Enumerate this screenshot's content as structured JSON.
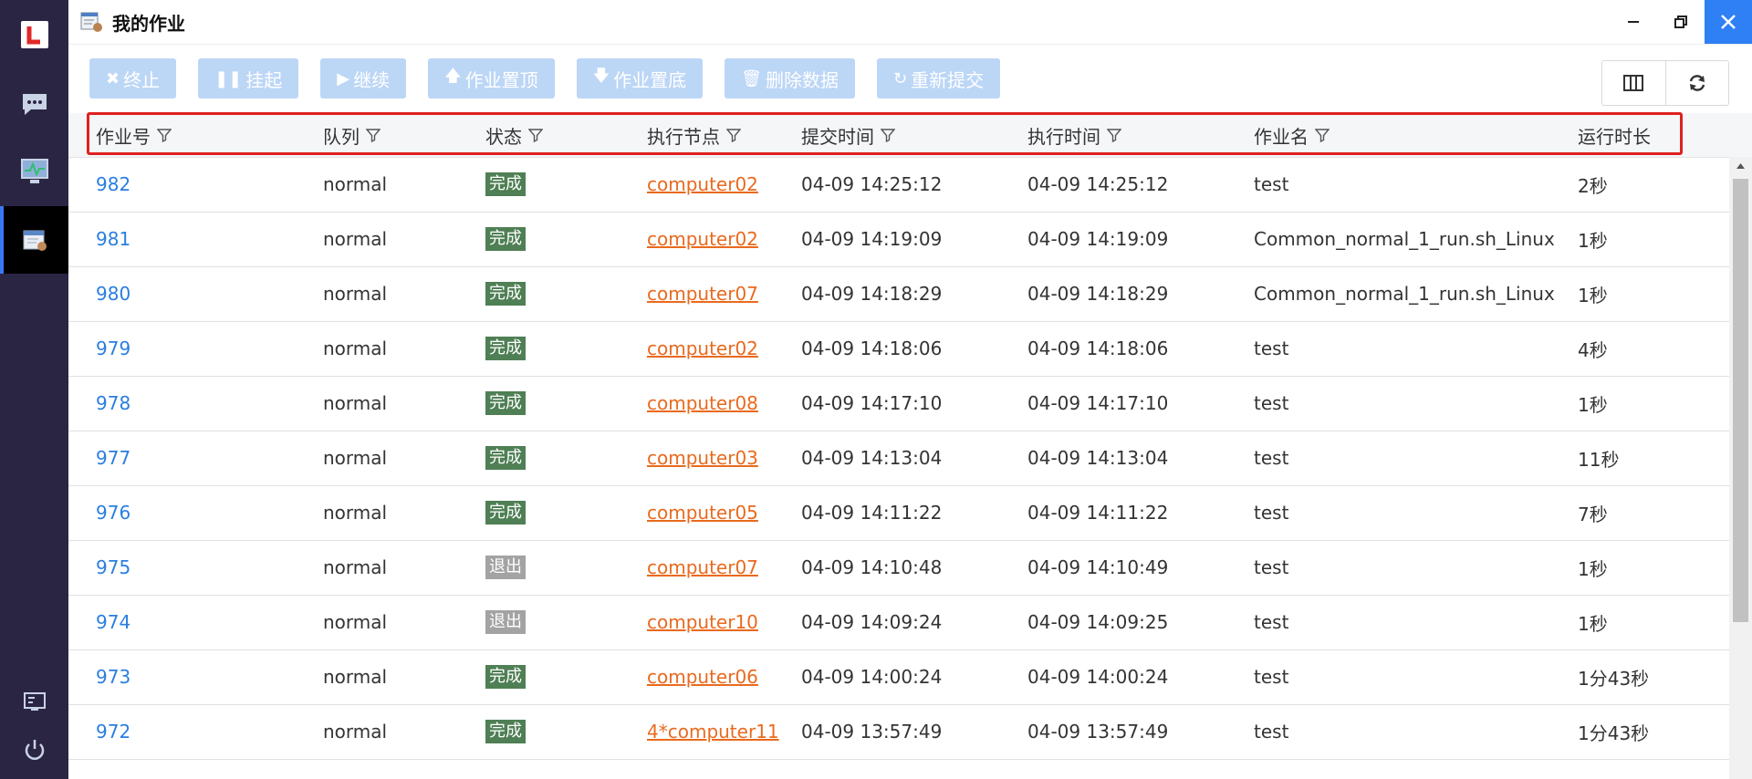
{
  "window": {
    "title": "我的作业"
  },
  "toolbar": {
    "buttons": [
      {
        "label": "终止",
        "glyph": "✖"
      },
      {
        "label": "挂起",
        "glyph": "❚❚"
      },
      {
        "label": "继续",
        "glyph": "▶"
      },
      {
        "label": "作业置顶",
        "glyph": "🡅"
      },
      {
        "label": "作业置底",
        "glyph": "🡇"
      },
      {
        "label": "删除数据",
        "glyph": "🗑"
      },
      {
        "label": "重新提交",
        "glyph": "↻"
      }
    ]
  },
  "table": {
    "columns": [
      "作业号",
      "队列",
      "状态",
      "执行节点",
      "提交时间",
      "执行时间",
      "作业名",
      "运行时长"
    ],
    "rows": [
      {
        "id": "982",
        "queue": "normal",
        "status": "完成",
        "node": "computer02",
        "submit": "04-09 14:25:12",
        "exec": "04-09 14:25:12",
        "name": "test",
        "duration": "2秒"
      },
      {
        "id": "981",
        "queue": "normal",
        "status": "完成",
        "node": "computer02",
        "submit": "04-09 14:19:09",
        "exec": "04-09 14:19:09",
        "name": "Common_normal_1_run.sh_Linux",
        "duration": "1秒"
      },
      {
        "id": "980",
        "queue": "normal",
        "status": "完成",
        "node": "computer07",
        "submit": "04-09 14:18:29",
        "exec": "04-09 14:18:29",
        "name": "Common_normal_1_run.sh_Linux",
        "duration": "1秒"
      },
      {
        "id": "979",
        "queue": "normal",
        "status": "完成",
        "node": "computer02",
        "submit": "04-09 14:18:06",
        "exec": "04-09 14:18:06",
        "name": "test",
        "duration": "4秒"
      },
      {
        "id": "978",
        "queue": "normal",
        "status": "完成",
        "node": "computer08",
        "submit": "04-09 14:17:10",
        "exec": "04-09 14:17:10",
        "name": "test",
        "duration": "1秒"
      },
      {
        "id": "977",
        "queue": "normal",
        "status": "完成",
        "node": "computer03",
        "submit": "04-09 14:13:04",
        "exec": "04-09 14:13:04",
        "name": "test",
        "duration": "11秒"
      },
      {
        "id": "976",
        "queue": "normal",
        "status": "完成",
        "node": "computer05",
        "submit": "04-09 14:11:22",
        "exec": "04-09 14:11:22",
        "name": "test",
        "duration": "7秒"
      },
      {
        "id": "975",
        "queue": "normal",
        "status": "退出",
        "node": "computer07",
        "submit": "04-09 14:10:48",
        "exec": "04-09 14:10:49",
        "name": "test",
        "duration": "1秒"
      },
      {
        "id": "974",
        "queue": "normal",
        "status": "退出",
        "node": "computer10",
        "submit": "04-09 14:09:24",
        "exec": "04-09 14:09:25",
        "name": "test",
        "duration": "1秒"
      },
      {
        "id": "973",
        "queue": "normal",
        "status": "完成",
        "node": "computer06",
        "submit": "04-09 14:00:24",
        "exec": "04-09 14:00:24",
        "name": "test",
        "duration": "1分43秒"
      },
      {
        "id": "972",
        "queue": "normal",
        "status": "完成",
        "node": "4*computer11",
        "submit": "04-09 13:57:49",
        "exec": "04-09 13:57:49",
        "name": "test",
        "duration": "1分43秒"
      }
    ]
  },
  "status_colors": {
    "完成": "#4f7f54",
    "退出": "#a3a3a3"
  },
  "colors": {
    "accent": "#2f7ff5",
    "sidebar": "#2b2544",
    "button_disabled": "#bcd6f6",
    "link": "#2a7ee0",
    "node_link": "#e96a1e",
    "highlight": "#e02020"
  }
}
